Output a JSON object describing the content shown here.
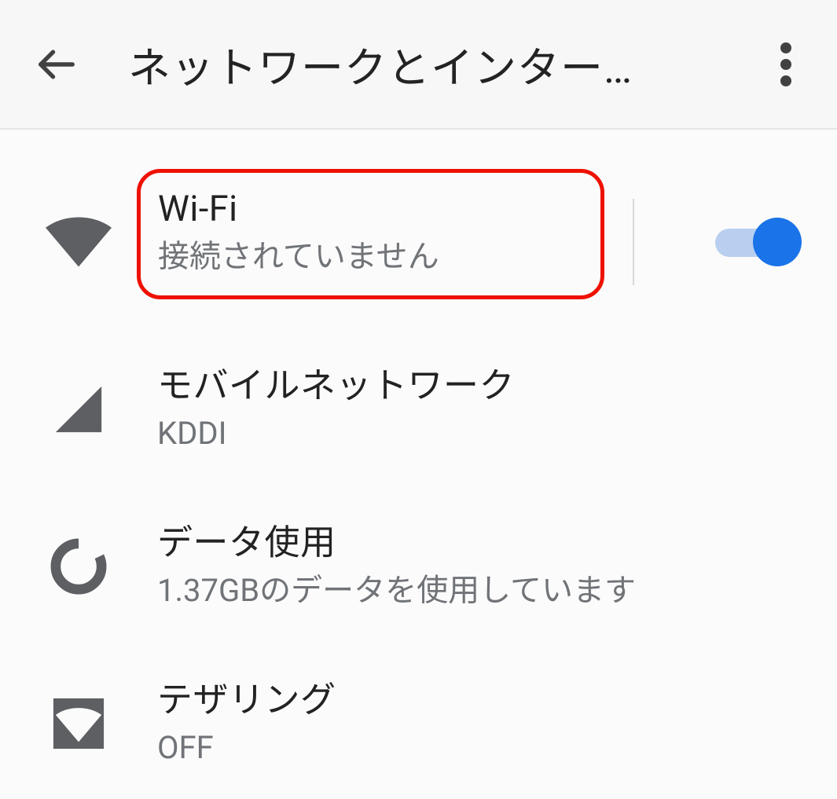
{
  "appbar": {
    "title": "ネットワークとインター…"
  },
  "items": [
    {
      "title": "Wi-Fi",
      "subtitle": "接続されていません",
      "toggle_on": true,
      "highlighted": true
    },
    {
      "title": "モバイルネットワーク",
      "subtitle": "KDDI"
    },
    {
      "title": "データ使用",
      "subtitle": "1.37GBのデータを使用しています"
    },
    {
      "title": "テザリング",
      "subtitle": "OFF"
    }
  ]
}
